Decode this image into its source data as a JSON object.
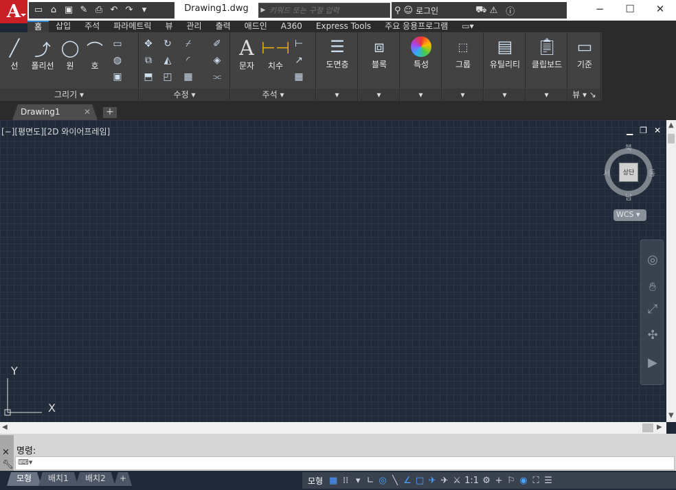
{
  "app": {
    "logo": "A"
  },
  "quick_access": [
    "new-icon",
    "open-icon",
    "save-icon",
    "saveas-icon",
    "print-icon",
    "undo-icon",
    "redo-icon",
    "customize-icon"
  ],
  "document_title": "Drawing1.dwg",
  "search": {
    "placeholder": "키워드 또는 구절 입력"
  },
  "user": {
    "login_label": "로그인"
  },
  "ribbon_tabs": [
    "홈",
    "삽입",
    "주석",
    "파라메트릭",
    "뷰",
    "관리",
    "출력",
    "애드인",
    "A360",
    "Express Tools",
    "주요 응용프로그램"
  ],
  "active_ribbon_tab": "홈",
  "panels": {
    "draw": {
      "title": "그리기",
      "line": "선",
      "polyline": "폴리선",
      "circle": "원",
      "arc": "호"
    },
    "modify": {
      "title": "수정"
    },
    "annotation": {
      "title": "주석",
      "text": "문자",
      "dimension": "치수"
    },
    "layers": {
      "label": "도면층"
    },
    "block": {
      "label": "블록"
    },
    "properties": {
      "label": "특성"
    },
    "groups": {
      "label": "그룹"
    },
    "utilities": {
      "label": "유틸리티"
    },
    "clipboard": {
      "label": "클립보드"
    },
    "view": {
      "label": "기준",
      "title": "뷰"
    }
  },
  "doc_tab": {
    "label": "Drawing1"
  },
  "viewport": {
    "label": "[−][평면도][2D 와이어프레임]"
  },
  "viewcube": {
    "north": "북",
    "south": "남",
    "east": "동",
    "west": "서",
    "face": "상단",
    "wcs": "WCS"
  },
  "ucs": {
    "x": "X",
    "y": "Y"
  },
  "command": {
    "label": "명령:"
  },
  "layout_tabs": [
    "모형",
    "배치1",
    "배치2"
  ],
  "status": {
    "model": "모형",
    "scale": "1:1"
  },
  "colors": {
    "accent": "#2e88d6",
    "logo_bg": "#c91f26",
    "canvas": "#212a38"
  }
}
